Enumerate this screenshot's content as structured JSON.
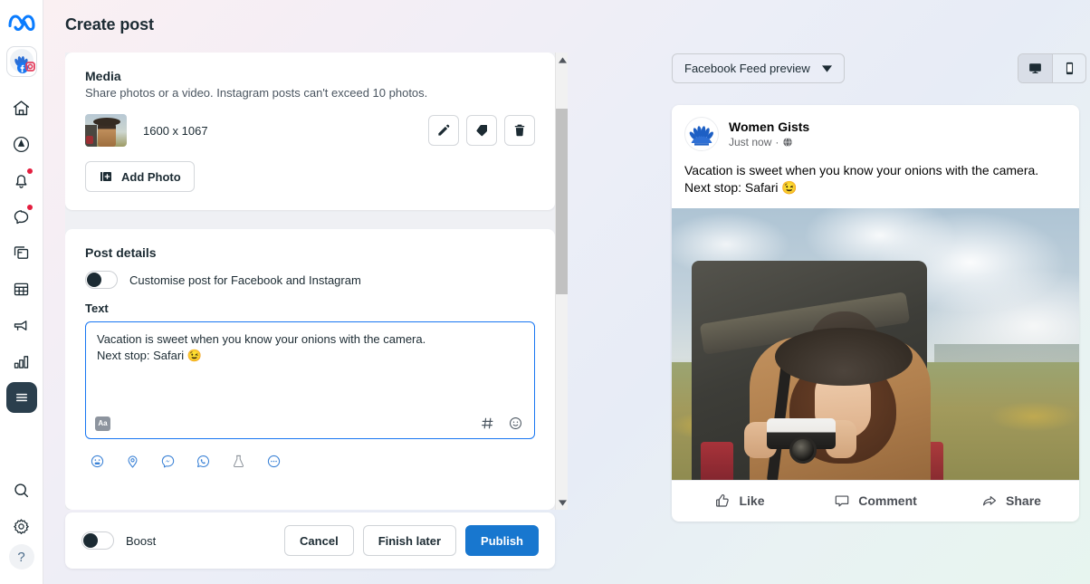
{
  "app": {
    "page_title": "Create post",
    "brand": "meta"
  },
  "sidebar": {
    "items": [
      {
        "name": "meta-logo",
        "label": "Meta"
      },
      {
        "name": "account-switcher",
        "label": "Women Gists account"
      },
      {
        "name": "home",
        "label": "Home"
      },
      {
        "name": "compass",
        "label": "Explore"
      },
      {
        "name": "notifications",
        "label": "Notifications",
        "badge": true
      },
      {
        "name": "messages",
        "label": "Messages",
        "badge": true
      },
      {
        "name": "content",
        "label": "Content"
      },
      {
        "name": "planner",
        "label": "Planner"
      },
      {
        "name": "ads",
        "label": "Ads"
      },
      {
        "name": "insights",
        "label": "Insights"
      },
      {
        "name": "all-tools",
        "label": "All tools",
        "active": true
      },
      {
        "name": "search",
        "label": "Search"
      },
      {
        "name": "settings",
        "label": "Settings"
      },
      {
        "name": "help",
        "label": "?"
      }
    ]
  },
  "media": {
    "title": "Media",
    "subtitle": "Share photos or a video. Instagram posts can't exceed 10 photos.",
    "item_dimensions": "1600 x 1067",
    "add_photo_label": "Add Photo",
    "actions": [
      {
        "name": "edit-media-button",
        "icon": "pencil-icon"
      },
      {
        "name": "tag-media-button",
        "icon": "tag-icon"
      },
      {
        "name": "delete-media-button",
        "icon": "trash-icon"
      }
    ]
  },
  "post_details": {
    "title": "Post details",
    "customise_toggle_label": "Customise post for Facebook and Instagram",
    "customise_toggle_on": false,
    "text_field_label": "Text",
    "text_value_line1": "Vacation is sweet when you know your onions with the camera.",
    "text_value_line2": "Next stop: Safari 😉",
    "editor_tools": [
      {
        "name": "font-style-button",
        "label": "Aa"
      },
      {
        "name": "hashtag-button",
        "label": "#"
      },
      {
        "name": "emoji-button",
        "label": "☺"
      }
    ],
    "attachment_icons": [
      {
        "name": "feeling-activity-icon"
      },
      {
        "name": "location-icon"
      },
      {
        "name": "messenger-icon"
      },
      {
        "name": "whatsapp-icon"
      },
      {
        "name": "ab-test-icon"
      },
      {
        "name": "more-options-icon"
      }
    ]
  },
  "footer": {
    "boost_label": "Boost",
    "boost_on": false,
    "cancel_label": "Cancel",
    "finish_later_label": "Finish later",
    "publish_label": "Publish"
  },
  "preview": {
    "selector_label": "Facebook Feed preview",
    "device_desktop_active": true,
    "post": {
      "author": "Women Gists",
      "timestamp": "Just now",
      "privacy": "Public",
      "body_line1": "Vacation is sweet when you know your onions with the camera.",
      "body_line2": "Next stop: Safari 😉",
      "actions": [
        {
          "name": "like-button",
          "label": "Like",
          "icon": "thumbs-up-icon"
        },
        {
          "name": "comment-button",
          "label": "Comment",
          "icon": "comment-bubble-icon"
        },
        {
          "name": "share-button",
          "label": "Share",
          "icon": "share-arrow-icon"
        }
      ]
    }
  },
  "colors": {
    "accent_blue": "#1877cf",
    "focus_border": "#1876f2",
    "rail_active": "#2b3f4d",
    "badge_red": "#e41e3f",
    "text_primary": "#1c2b33",
    "text_secondary": "#65676b"
  }
}
